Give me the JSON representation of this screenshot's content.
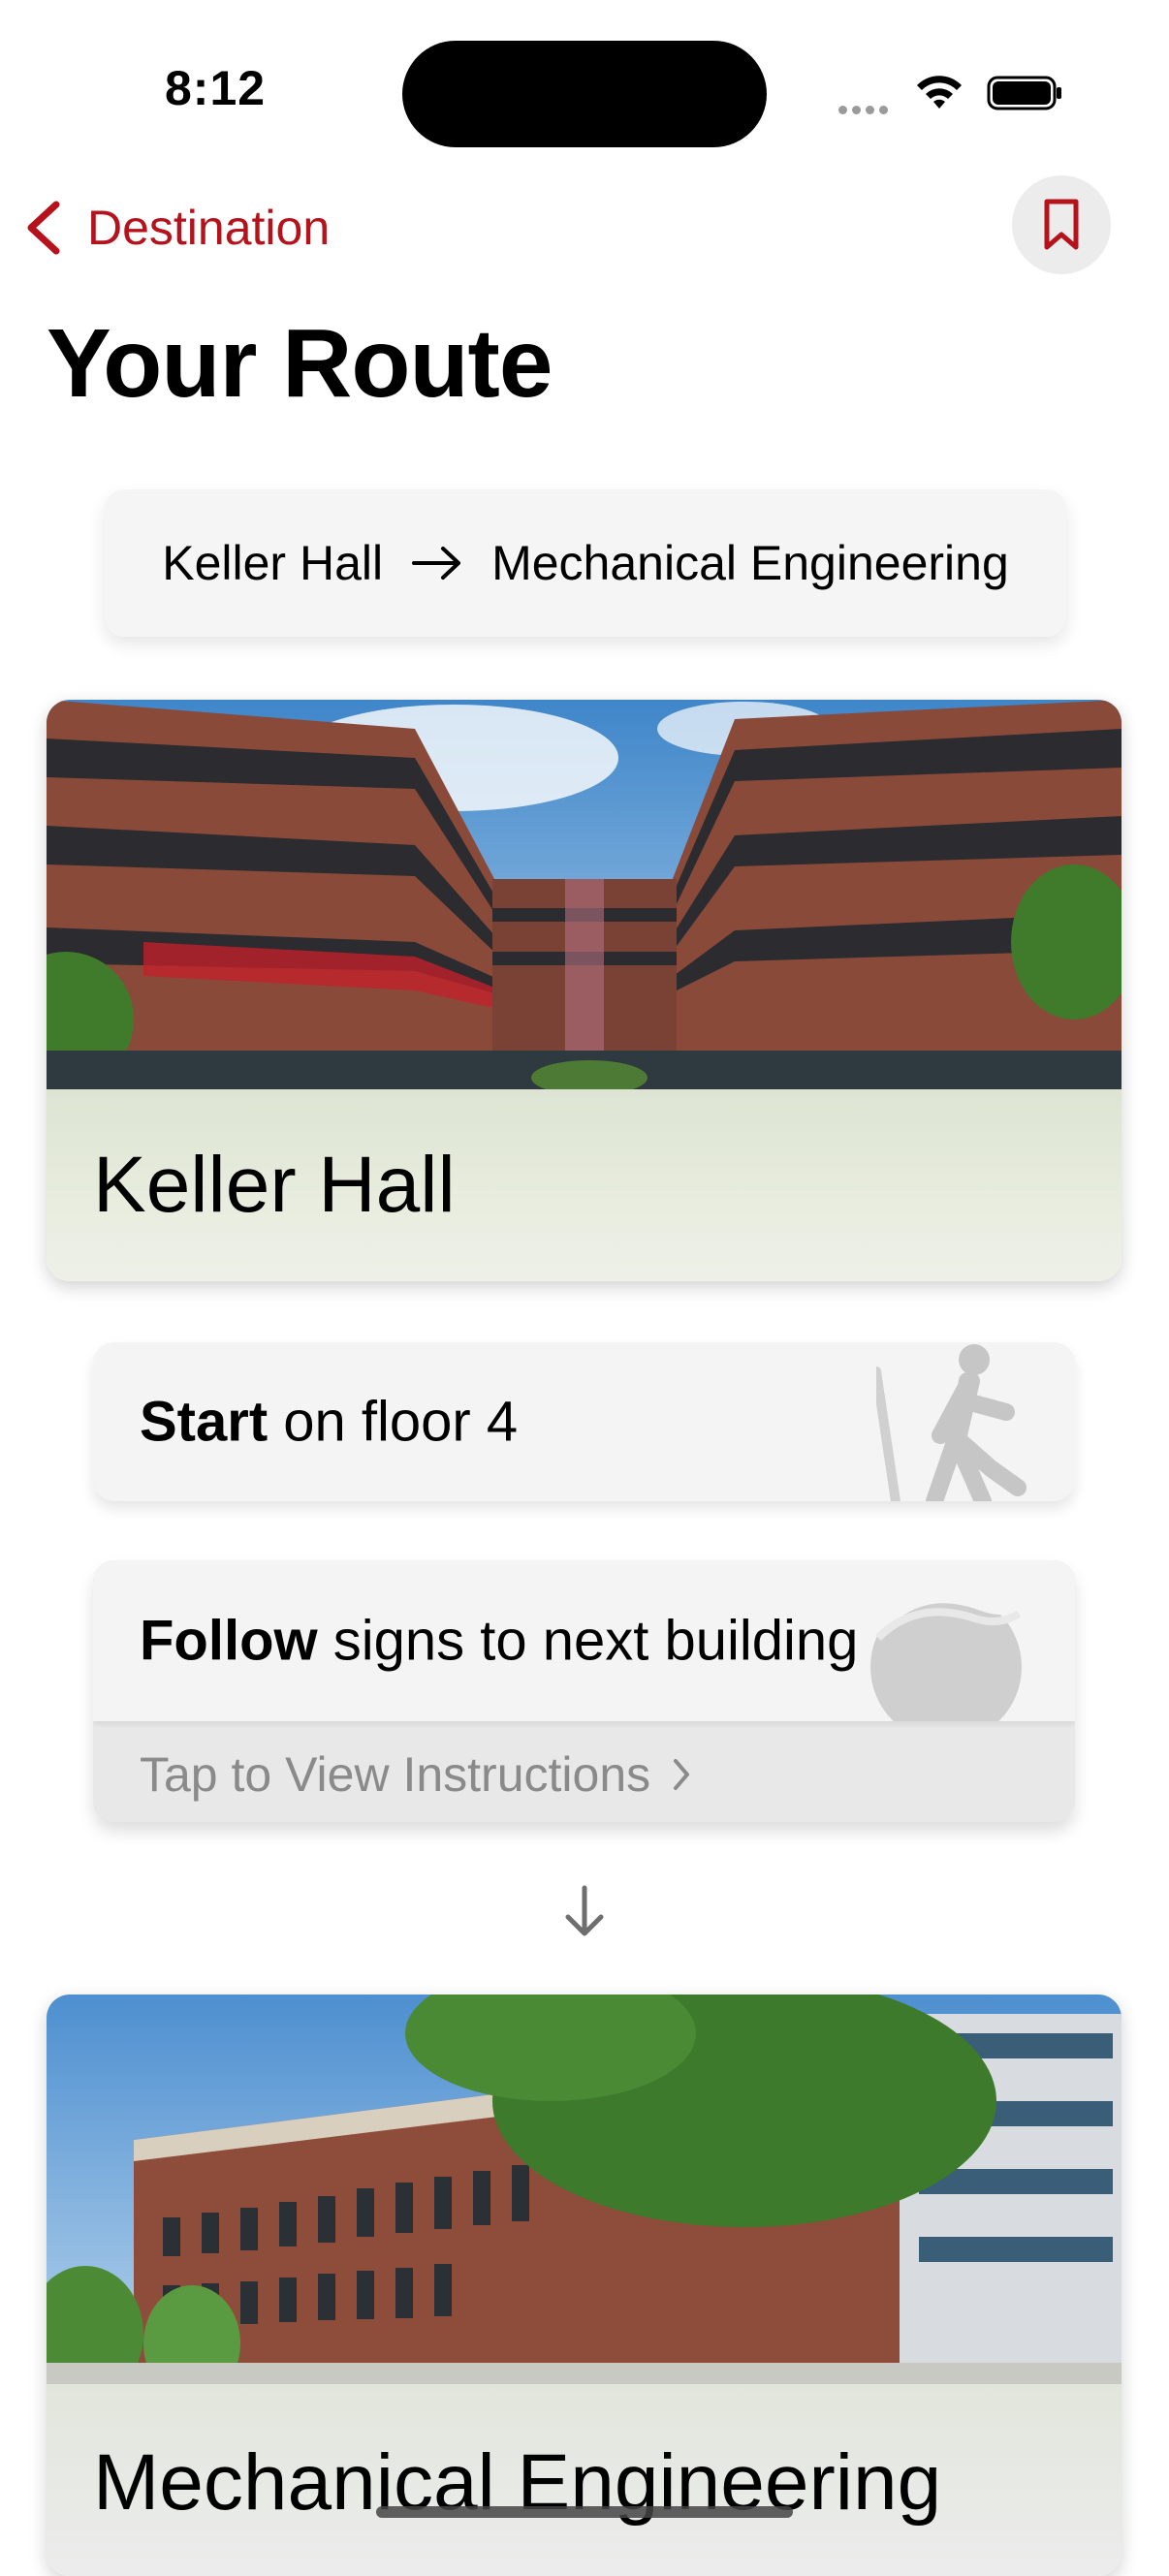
{
  "status_bar": {
    "time": "8:12"
  },
  "nav": {
    "back_label": "Destination"
  },
  "page": {
    "title": "Your Route"
  },
  "route": {
    "from": "Keller Hall",
    "to": "Mechanical Engineering"
  },
  "origin": {
    "name": "Keller Hall"
  },
  "steps": [
    {
      "bold": "Start",
      "rest": " on floor 4",
      "icon": "walking-person-icon"
    },
    {
      "bold": "Follow",
      "rest": " signs to next building",
      "icon": "globe-icon",
      "hint": "Tap to View Instructions"
    }
  ],
  "destination": {
    "name": "Mechanical Engineering"
  },
  "colors": {
    "accent": "#b5121b",
    "background": "#ffffff",
    "card": "#f4f4f4"
  }
}
